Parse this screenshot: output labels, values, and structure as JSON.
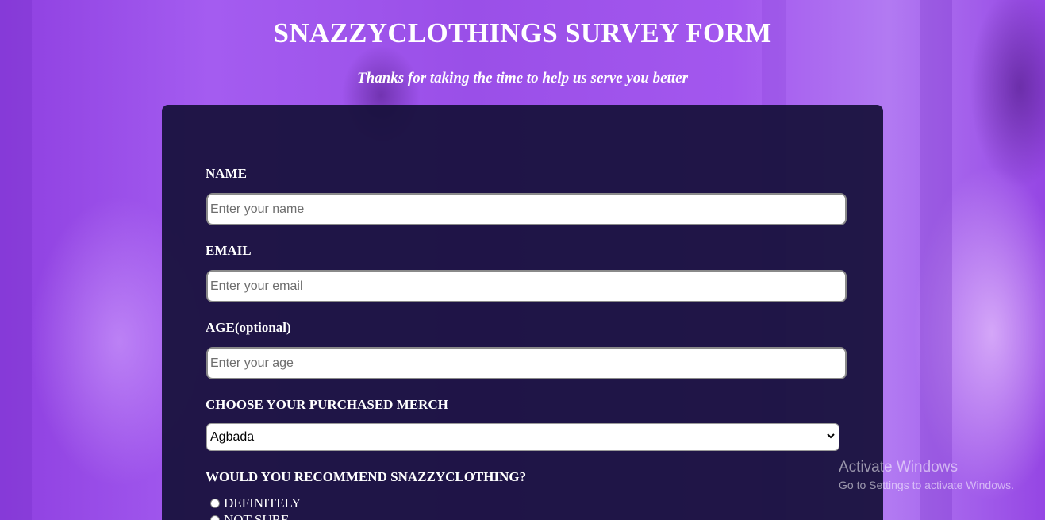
{
  "header": {
    "title": "SNAZZYCLOTHINGS SURVEY FORM",
    "subtitle": "Thanks for taking the time to help us serve you better"
  },
  "form": {
    "name": {
      "label": "NAME",
      "placeholder": "Enter your name",
      "value": ""
    },
    "email": {
      "label": "EMAIL",
      "placeholder": "Enter your email",
      "value": ""
    },
    "age": {
      "label": "AGE(optional)",
      "placeholder": "Enter your age",
      "value": ""
    },
    "merch": {
      "label": "CHOOSE YOUR PURCHASED MERCH",
      "selected": "Agbada"
    },
    "recommend": {
      "label": "WOULD YOU RECOMMEND SNAZZYCLOTHING?",
      "options": [
        "DEFINITELY",
        "NOT SURE"
      ]
    }
  },
  "watermark": {
    "title": "Activate Windows",
    "subtitle": "Go to Settings to activate Windows."
  },
  "icons": {
    "select_arrow": "chevron-down-icon"
  },
  "colors": {
    "background": "#9b4de6",
    "card": "#16103a",
    "text": "#ffffff"
  }
}
